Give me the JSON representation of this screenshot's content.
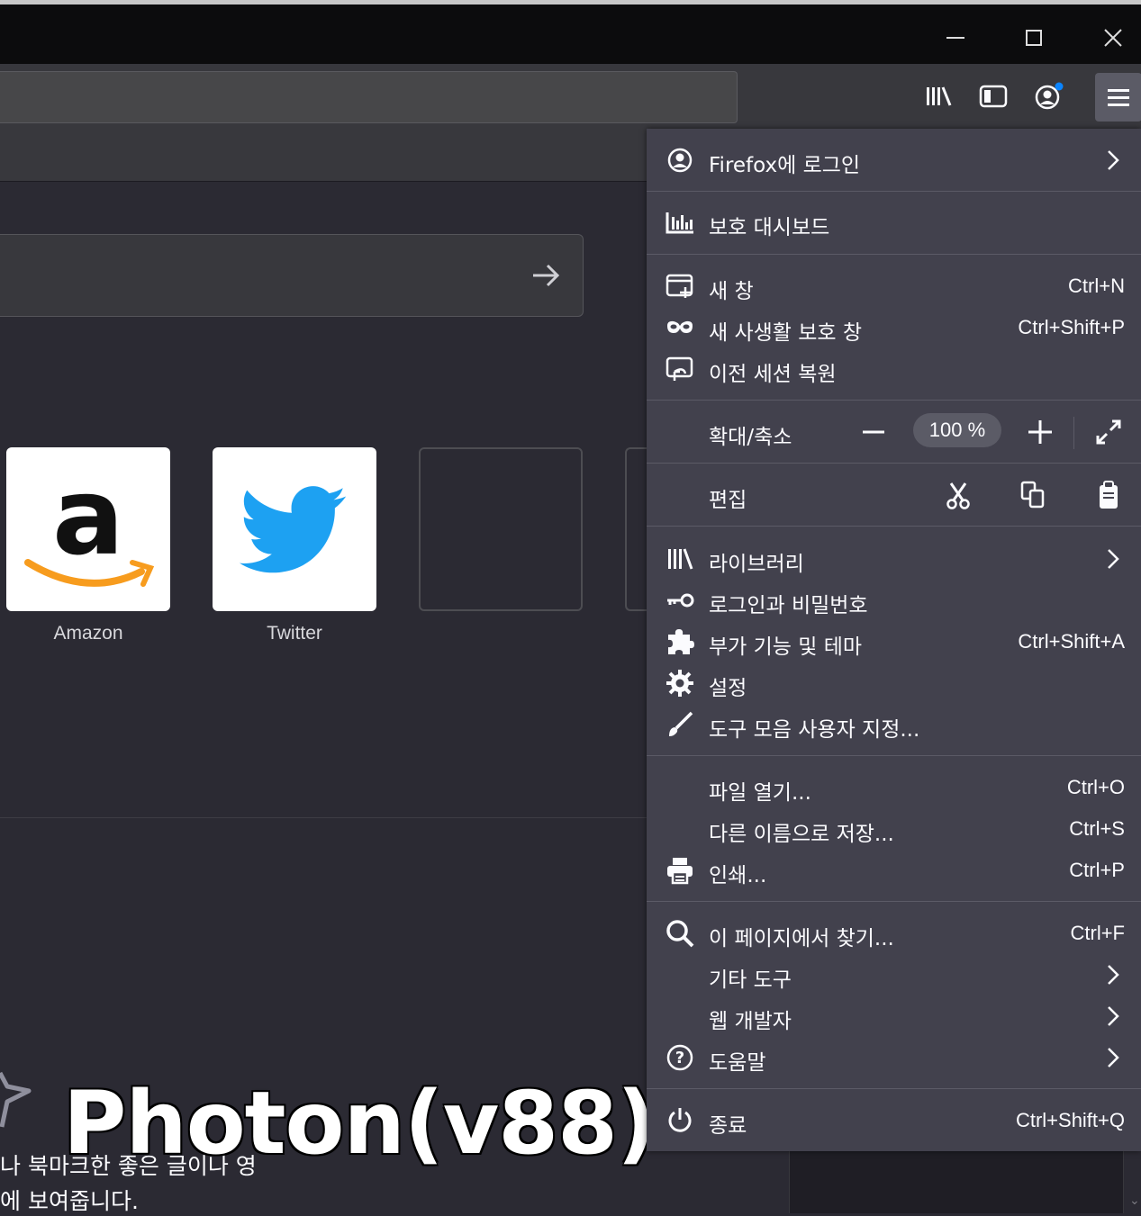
{
  "window": {
    "minimize": "minimize-icon",
    "maximize": "maximize-icon",
    "close": "close-icon"
  },
  "toolbar": {
    "icons": [
      "library-icon",
      "sidebar-icon",
      "account-icon",
      "hamburger-menu-icon"
    ],
    "notification_dot_color": "#0a84ff"
  },
  "newtab": {
    "tiles": [
      {
        "label": "Amazon",
        "icon": "amazon-logo"
      },
      {
        "label": "Twitter",
        "icon": "twitter-logo"
      },
      {
        "label": "",
        "icon": ""
      }
    ],
    "highlight_line1": "나 북마크한 좋은 글이나 영",
    "highlight_line2": "에 보여줍니다."
  },
  "overlay_title": "Photon(v88)",
  "menu": {
    "signin": "Firefox에 로그인",
    "protections": "보호 대시보드",
    "new_window": {
      "label": "새 창",
      "shortcut": "Ctrl+N"
    },
    "private_window": {
      "label": "새 사생활 보호 창",
      "shortcut": "Ctrl+Shift+P"
    },
    "restore_session": {
      "label": "이전 세션 복원"
    },
    "zoom": {
      "label": "확대/축소",
      "value": "100 %"
    },
    "edit": {
      "label": "편집"
    },
    "library": {
      "label": "라이브러리"
    },
    "logins": {
      "label": "로그인과 비밀번호"
    },
    "addons": {
      "label": "부가 기능 및 테마",
      "shortcut": "Ctrl+Shift+A"
    },
    "settings": {
      "label": "설정"
    },
    "customize": {
      "label": "도구 모음 사용자 지정..."
    },
    "open_file": {
      "label": "파일 열기...",
      "shortcut": "Ctrl+O"
    },
    "save_as": {
      "label": "다른 이름으로 저장...",
      "shortcut": "Ctrl+S"
    },
    "print": {
      "label": "인쇄...",
      "shortcut": "Ctrl+P"
    },
    "find": {
      "label": "이 페이지에서 찾기...",
      "shortcut": "Ctrl+F"
    },
    "more_tools": {
      "label": "기타 도구"
    },
    "web_dev": {
      "label": "웹 개발자"
    },
    "help": {
      "label": "도움말"
    },
    "quit": {
      "label": "종료",
      "shortcut": "Ctrl+Shift+Q"
    }
  }
}
